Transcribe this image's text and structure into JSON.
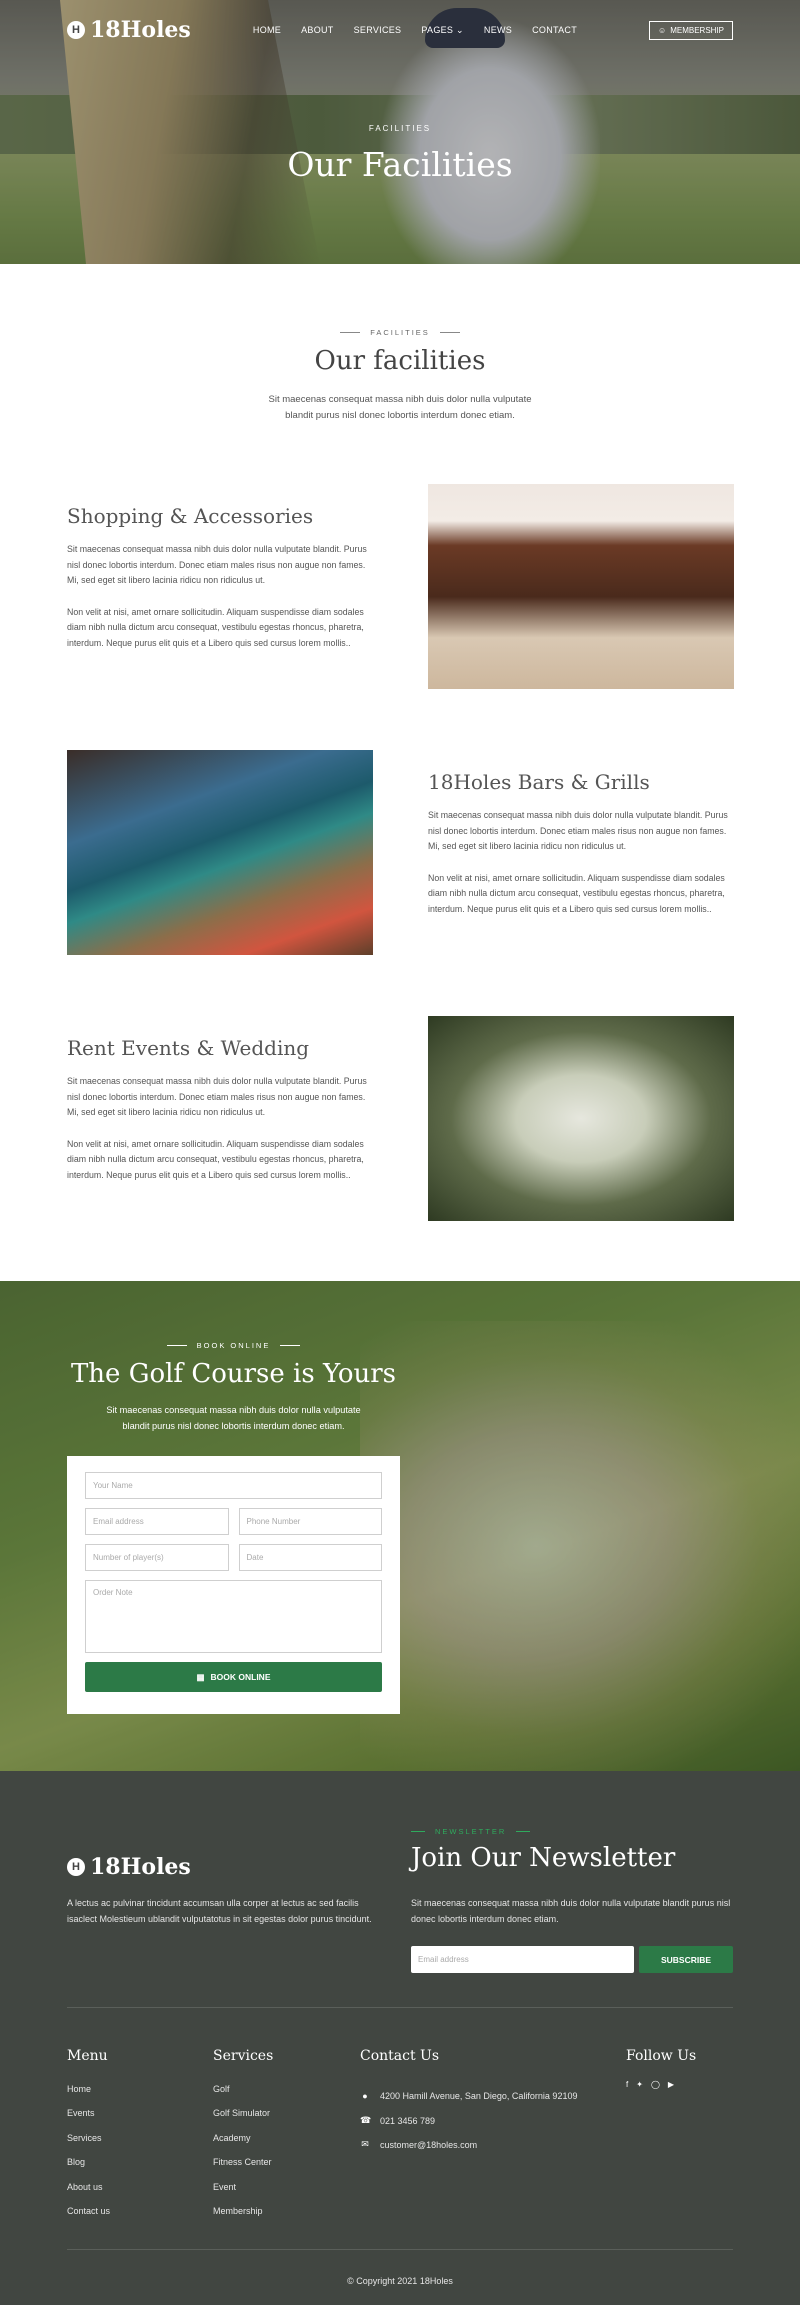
{
  "nav": {
    "logo": "18Holes",
    "logo_mark": "H",
    "items": [
      "HOME",
      "ABOUT",
      "SERVICES",
      "PAGES",
      "NEWS",
      "CONTACT"
    ],
    "membership": "MEMBERSHIP"
  },
  "hero": {
    "kicker": "FACILITIES",
    "title": "Our Facilities"
  },
  "intro": {
    "kicker": "FACILITIES",
    "title": "Our facilities",
    "text": "Sit maecenas consequat massa nibh duis dolor nulla vulputate blandit purus nisl donec lobortis interdum donec etiam."
  },
  "features": [
    {
      "title": "Shopping & Accessories",
      "p1": "Sit maecenas consequat massa nibh duis dolor nulla vulputate blandit. Purus nisl donec lobortis interdum. Donec etiam males risus non augue non fames. Mi, sed eget sit libero lacinia ridicu non ridiculus ut.",
      "p2": "Non velit at nisi, amet ornare sollicitudin. Aliquam suspendisse diam sodales diam nibh nulla dictum arcu consequat, vestibulu egestas rhoncus, pharetra, interdum. Neque purus elit quis et a Libero quis sed cursus lorem mollis.."
    },
    {
      "title": "18Holes Bars & Grills",
      "p1": "Sit maecenas consequat massa nibh duis dolor nulla vulputate blandit. Purus nisl donec lobortis interdum. Donec etiam males risus non augue non fames. Mi, sed eget sit libero lacinia ridicu non ridiculus ut.",
      "p2": "Non velit at nisi, amet ornare sollicitudin. Aliquam suspendisse diam sodales diam nibh nulla dictum arcu consequat, vestibulu egestas rhoncus, pharetra, interdum. Neque purus elit quis et a Libero quis sed cursus lorem mollis.."
    },
    {
      "title": "Rent Events & Wedding",
      "p1": "Sit maecenas consequat massa nibh duis dolor nulla vulputate blandit. Purus nisl donec lobortis interdum. Donec etiam males risus non augue non fames. Mi, sed eget sit libero lacinia ridicu non ridiculus ut.",
      "p2": "Non velit at nisi, amet ornare sollicitudin. Aliquam suspendisse diam sodales diam nibh nulla dictum arcu consequat, vestibulu egestas rhoncus, pharetra, interdum. Neque purus elit quis et a Libero quis sed cursus lorem mollis.."
    }
  ],
  "booking": {
    "kicker": "BOOK ONLINE",
    "title": "The Golf Course is Yours",
    "text": "Sit maecenas consequat massa nibh duis dolor nulla vulputate blandit purus nisl donec lobortis interdum donec etiam.",
    "name_placeholder": "Your Name",
    "email_placeholder": "Email address",
    "phone_placeholder": "Phone Number",
    "players_placeholder": "Number of player(s)",
    "date_placeholder": "Date",
    "note_placeholder": "Order Note",
    "button": "BOOK ONLINE"
  },
  "footer": {
    "logo": "18Holes",
    "logo_mark": "H",
    "description": "A lectus ac pulvinar tincidunt accumsan ulla corper at lectus ac sed facilis isaclect Molestieum ublandit vulputatotus in sit egestas dolor purus tincidunt.",
    "newsletter": {
      "kicker": "NEWSLETTER",
      "title": "Join Our Newsletter",
      "text": "Sit maecenas consequat massa nibh duis dolor nulla vulputate blandit purus nisl donec lobortis interdum donec etiam.",
      "placeholder": "Email address",
      "button": "SUBSCRIBE"
    },
    "menu": {
      "title": "Menu",
      "items": [
        "Home",
        "Events",
        "Services",
        "Blog",
        "About us",
        "Contact us"
      ]
    },
    "services": {
      "title": "Services",
      "items": [
        "Golf",
        "Golf Simulator",
        "Academy",
        "Fitness Center",
        "Event",
        "Membership"
      ]
    },
    "contact": {
      "title": "Contact Us",
      "address": "4200 Hamill Avenue, San Diego, California 92109",
      "phone": "021 3456 789",
      "email": "customer@18holes.com"
    },
    "follow": {
      "title": "Follow Us",
      "icons": [
        "facebook-icon",
        "twitter-icon",
        "instagram-icon",
        "youtube-icon"
      ]
    },
    "copyright": "© Copyright 2021 18Holes"
  },
  "colors": {
    "accent": "#2c7a47",
    "footer_bg": "#414641"
  }
}
